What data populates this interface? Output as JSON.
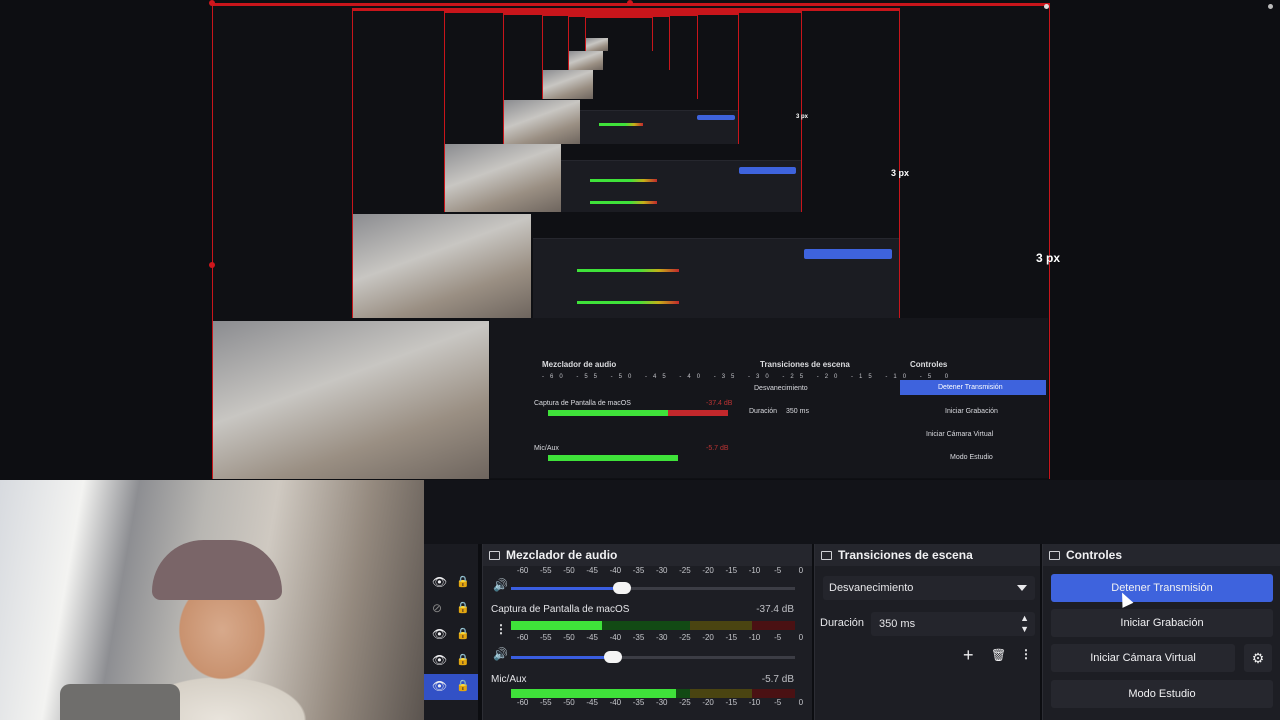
{
  "preview": {
    "measure_labels": [
      "3 px",
      "3 px",
      "3 px"
    ],
    "mini_dock": {
      "mixer_title": "Mezclador de audio",
      "transitions_title": "Transiciones de escena",
      "controls_title": "Controles",
      "scale": "-60 -55 -50 -45 -40 -35 -30 -25 -20 -15 -10 -5 0",
      "channel1_name": "Captura de Pantalla de macOS",
      "channel1_db": "-37.4 dB",
      "channel2_name": "Mic/Aux",
      "channel2_db": "-5.7 dB",
      "transition_value": "Desvanecimiento",
      "duration_label": "Duración",
      "duration_value": "350 ms",
      "btn_stop": "Detener Transmisión",
      "btn_record": "Iniciar Grabación",
      "btn_vcam": "Iniciar Cámara Virtual",
      "btn_studio": "Modo Estudio"
    }
  },
  "mixer": {
    "title": "Mezclador de audio",
    "scale": [
      "-60",
      "-55",
      "-50",
      "-45",
      "-40",
      "-35",
      "-30",
      "-25",
      "-20",
      "-15",
      "-10",
      "-5",
      "0"
    ],
    "channels": [
      {
        "name": "Captura de Pantalla de macOS",
        "db": "-37.4 dB",
        "level": 0.32
      },
      {
        "name": "Mic/Aux",
        "db": "-5.7 dB",
        "level": 0.58
      }
    ],
    "top_slider_level": 0.39,
    "ch1_slider_level": 0.36
  },
  "transitions": {
    "title": "Transiciones de escena",
    "selected": "Desvanecimiento",
    "duration_label": "Duración",
    "duration_value": "350 ms",
    "add_icon": "+",
    "trash_icon": "🗑",
    "more_icon": "⋮"
  },
  "controls": {
    "title": "Controles",
    "stop_stream": "Detener Transmisión",
    "start_recording": "Iniciar Grabación",
    "start_virtual_camera": "Iniciar Cámara Virtual",
    "studio_mode": "Modo Estudio",
    "gear_icon": "⚙"
  },
  "sources": {
    "rows": [
      {
        "visible": true,
        "icon": "eye-icon"
      },
      {
        "visible": false,
        "icon": "eye-slash-icon"
      },
      {
        "visible": true,
        "icon": "eye-icon"
      },
      {
        "visible": true,
        "icon": "eye-icon"
      },
      {
        "visible": true,
        "icon": "eye-icon",
        "selected": true
      }
    ]
  },
  "colors": {
    "accent": "#3e63dd",
    "border_red": "#c8151b",
    "meter_green": "#3fe23a",
    "meter_yellow": "#c4b018",
    "meter_red": "#c3282c"
  }
}
